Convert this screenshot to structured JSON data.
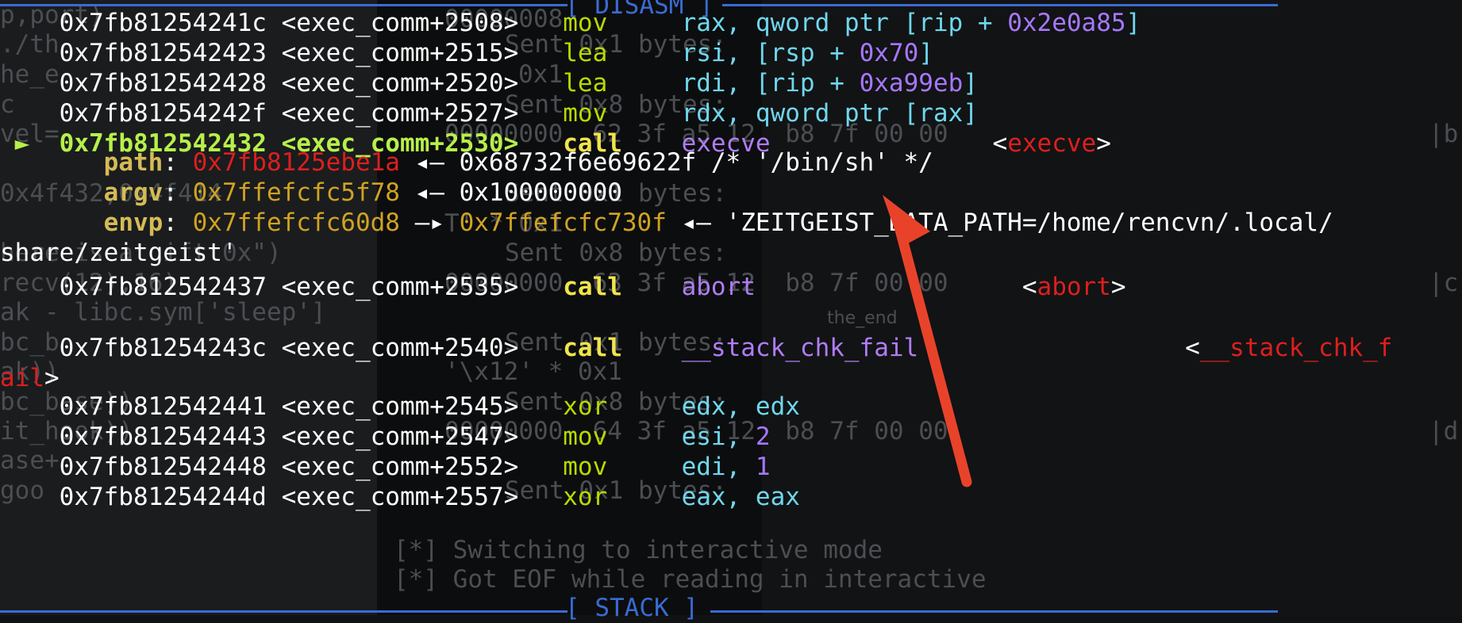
{
  "banners": {
    "disasm": "[ DISASM ]",
    "stack": "[ STACK ]"
  },
  "background_text": [
    "p,port)",
    "./th",
    "he_e",
    "c",
    "vel=",
    "0x4f432,0x4f414",
    "here is a gift 0x\")",
    "recv(12),16)",
    "ak - libc.sym['sleep']",
    "bc_b",
    "ak))",
    "bc_base))",
    "it_hook))",
    "ase+",
    "goo",
    "00000008",
    "Sent 0x1 bytes:",
    "0x1",
    "Sent 0x8 bytes:",
    "00000000  62 3f a5 12  b8 7f 00 00",
    "Sent 0x1 bytes:",
    "T' * 0x1",
    "Sent 0x8 bytes:",
    "00000000  63 3f a5 12  b8 7f 00 00",
    "Sent 0x1 bytes:",
    "'\\x12' * 0x1",
    "Sent 0x8 bytes:",
    "00000000  64 3f a5 12  b8 7f 00 00",
    "Sent 0x1 bytes:",
    "[*] Switching to interactive mode",
    "[*] Got EOF while reading in interactive",
    "the_end",
    "|b",
    "|c",
    "|d"
  ],
  "lines": [
    {
      "addr": "0x7fb81254241c",
      "sym": "<exec_comm+2508>",
      "op": "mov",
      "args": [
        [
          "reg",
          "rax"
        ],
        [
          "txt",
          ", "
        ],
        [
          "reg",
          "qword ptr ["
        ],
        [
          "reg",
          "rip"
        ],
        [
          "txt",
          " + "
        ],
        [
          "num",
          "0x2e0a85"
        ],
        [
          "reg",
          "]"
        ]
      ]
    },
    {
      "addr": "0x7fb812542423",
      "sym": "<exec_comm+2515>",
      "op": "lea",
      "args": [
        [
          "reg",
          "rsi"
        ],
        [
          "txt",
          ", ["
        ],
        [
          "reg",
          "rsp"
        ],
        [
          "txt",
          " + "
        ],
        [
          "num",
          "0x70"
        ],
        [
          "txt",
          "]"
        ]
      ]
    },
    {
      "addr": "0x7fb812542428",
      "sym": "<exec_comm+2520>",
      "op": "lea",
      "args": [
        [
          "reg",
          "rdi"
        ],
        [
          "txt",
          ", ["
        ],
        [
          "reg",
          "rip"
        ],
        [
          "txt",
          " + "
        ],
        [
          "num",
          "0xa99eb"
        ],
        [
          "txt",
          "]"
        ]
      ]
    },
    {
      "addr": "0x7fb81254242f",
      "sym": "<exec_comm+2527>",
      "op": "mov",
      "args": [
        [
          "reg",
          "rdx"
        ],
        [
          "txt",
          ", "
        ],
        [
          "reg",
          "qword ptr ["
        ],
        [
          "reg",
          "rax"
        ],
        [
          "reg",
          "]"
        ]
      ]
    },
    {
      "addr": "0x7fb812542432",
      "sym": "<exec_comm+2530>",
      "op": "call",
      "current": true,
      "target": "execve",
      "target_sym": "execve"
    },
    {
      "addr": "0x7fb812542437",
      "sym": "<exec_comm+2535>",
      "op": "call",
      "target": "abort",
      "target_sym": "abort"
    },
    {
      "addr": "0x7fb81254243c",
      "sym": "<exec_comm+2540>",
      "op": "call",
      "target": "__stack_chk_fail",
      "target_sym_a": "__stack_chk_f",
      "target_sym_b": "ail"
    },
    {
      "addr": "0x7fb812542441",
      "sym": "<exec_comm+2545>",
      "op": "xor",
      "args": [
        [
          "reg",
          "edx"
        ],
        [
          "txt",
          ", "
        ],
        [
          "reg",
          "edx"
        ]
      ]
    },
    {
      "addr": "0x7fb812542443",
      "sym": "<exec_comm+2547>",
      "op": "mov",
      "args": [
        [
          "reg",
          "esi"
        ],
        [
          "txt",
          ", "
        ],
        [
          "num",
          "2"
        ]
      ]
    },
    {
      "addr": "0x7fb812542448",
      "sym": "<exec_comm+2552>",
      "op": "mov",
      "args": [
        [
          "reg",
          "edi"
        ],
        [
          "txt",
          ", "
        ],
        [
          "num",
          "1"
        ]
      ]
    },
    {
      "addr": "0x7fb81254244d",
      "sym": "<exec_comm+2557>",
      "op": "xor",
      "args": [
        [
          "reg",
          "eax"
        ],
        [
          "txt",
          ", "
        ],
        [
          "reg",
          "eax"
        ]
      ]
    }
  ],
  "execve_args": {
    "path_label": "path",
    "path_ptr": "0x7fb8125ebe1a",
    "path_val": "0x68732f6e69622f /* '/bin/sh' */",
    "argv_label": "argv",
    "argv_ptr": "0x7ffefcfc5f78",
    "argv_val": "0x100000000",
    "envp_label": "envp",
    "envp_ptr": "0x7ffefcfc60d8",
    "envp_ptr2": "0x7ffefcfc730f",
    "envp_val": "'ZEITGEIST_DATA_PATH=/home/rencvn/.local/",
    "envp_wrap": "share/zeitgeist'"
  },
  "colors": {
    "accent": "#3a6bd4",
    "annotation_arrow": "#e8432a"
  }
}
